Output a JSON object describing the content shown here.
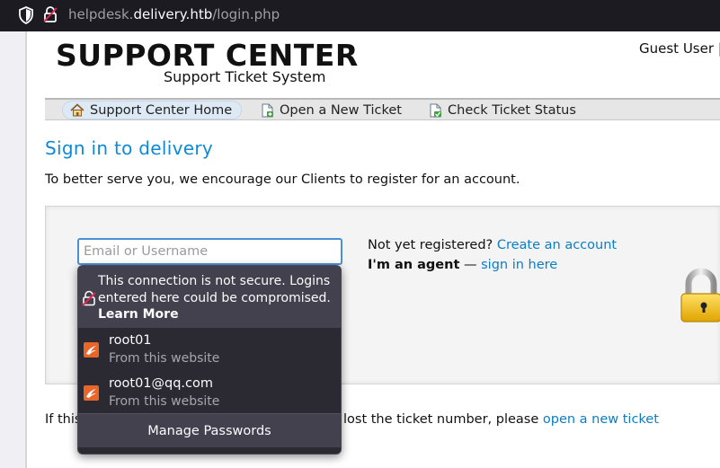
{
  "browser": {
    "url_host_prefix": "helpdesk.",
    "url_host": "delivery.htb",
    "url_path": "/login.php"
  },
  "header": {
    "logo_title": "SUPPORT CENTER",
    "logo_subtitle": "Support Ticket System",
    "guest_label": "Guest User |"
  },
  "nav": {
    "items": [
      {
        "label": "Support Center Home"
      },
      {
        "label": "Open a New Ticket"
      },
      {
        "label": "Check Ticket Status"
      }
    ]
  },
  "main": {
    "title": "Sign in to delivery",
    "intro": "To better serve you, we encourage our Clients to register for an account.",
    "email_placeholder": "Email or Username",
    "not_registered": "Not yet registered?",
    "create_account": "Create an account",
    "agent_label": "I'm an agent",
    "agent_sep": "—",
    "sign_in_here": "sign in here",
    "bottom_prefix": "If this",
    "bottom_suffix": "lost the ticket number, please",
    "open_new_ticket": "open a new ticket"
  },
  "autofill": {
    "warning_text": "This connection is not secure. Logins entered here could be compromised.",
    "learn_more": "Learn More",
    "entries": [
      {
        "username": "root01",
        "source": "From this website"
      },
      {
        "username": "root01@qq.com",
        "source": "From this website"
      }
    ],
    "manage_label": "Manage Passwords"
  }
}
